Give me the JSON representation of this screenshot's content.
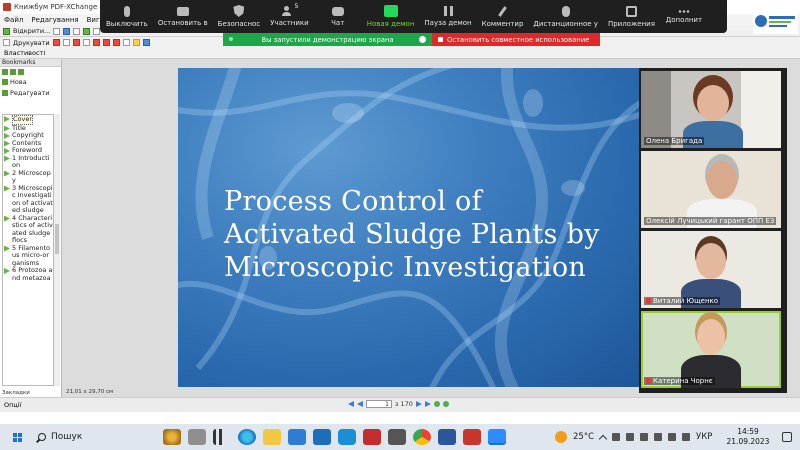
{
  "app": {
    "title": "Книжбум  PDF-XChange Editor",
    "menu": [
      "Файл",
      "Редагування",
      "Вигляд"
    ],
    "toolbar_left_label": "Відкрити...",
    "toolbar2_label": "Друкувати",
    "toolbar3_label": "Властивості"
  },
  "sidebar": {
    "tab_label": "Bookmarks",
    "links": [
      {
        "label": "Нова"
      },
      {
        "label": "Редагувати"
      }
    ],
    "bookmarks_label": "Закладки",
    "items": [
      {
        "label": "Cover",
        "selected": true
      },
      {
        "label": "Title"
      },
      {
        "label": "Copyright"
      },
      {
        "label": "Contents"
      },
      {
        "label": "Foreword"
      },
      {
        "label": "1 Introduction"
      },
      {
        "label": "2 Microscopy"
      },
      {
        "label": "3 Microscopic Investigation of activated sludge"
      },
      {
        "label": "4 Characteristics of activated sludge flocs"
      },
      {
        "label": "5 Filamentous micro-organisms"
      },
      {
        "label": "6 Protozoa and metazoa"
      }
    ],
    "bottom_label": "Закладки",
    "mode_label": "Опції"
  },
  "document": {
    "slide_title_lines": [
      "Process Control of",
      "Activated Sludge Plants by",
      "Microscopic Investigation"
    ],
    "page_size_label": "21,01 x 29,70 см",
    "page_current": "1",
    "page_total": "з 170"
  },
  "zoom": {
    "toolbar": [
      {
        "label": "Выключить",
        "icon": "mic-icon"
      },
      {
        "label": "Остановить в",
        "icon": "camera-icon"
      },
      {
        "label": "Безопаснос",
        "icon": "shield-icon"
      },
      {
        "label": "Участники",
        "icon": "participants-icon",
        "count": "5"
      },
      {
        "label": "Чат",
        "icon": "chat-icon"
      },
      {
        "label": "Новая демон",
        "icon": "share-screen-icon",
        "accent": true
      },
      {
        "label": "Пауза демон",
        "icon": "pause-icon"
      },
      {
        "label": "Комментир",
        "icon": "annotate-icon"
      },
      {
        "label": "Дистанционное у",
        "icon": "remote-control-icon"
      },
      {
        "label": "Приложения",
        "icon": "apps-icon"
      },
      {
        "label": "Дополнит",
        "icon": "more-icon"
      }
    ],
    "banner_sharing": "Вы запустили демонстрацию экрана",
    "banner_stop": "Остановить совместное использование",
    "participants": [
      {
        "name": "Олена Бригада",
        "muted": false,
        "active": false
      },
      {
        "name": "Олексій Лучицький гарант ОПП ЕЗ",
        "muted": false,
        "active": false
      },
      {
        "name": "Виталий Ющенко",
        "muted": true,
        "active": false
      },
      {
        "name": "Катерина Чорнє",
        "muted": true,
        "active": true
      }
    ]
  },
  "taskbar": {
    "search_label": "Пошук",
    "weather": "25°C",
    "language": "УКР",
    "time": "14:59",
    "date": "21.09.2023"
  },
  "colors": {
    "zoom_bg": "#1f1f1f",
    "share_green": "#1ea64a",
    "stop_red": "#e02828",
    "slide_blue": "#2a68ad",
    "taskbar": "#dfe6ee"
  }
}
